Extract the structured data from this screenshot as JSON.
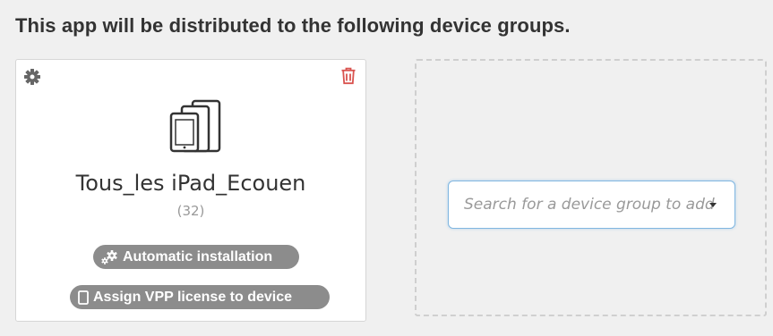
{
  "heading": "This app will be distributed to the following device groups.",
  "group_card": {
    "name": "Tous_les iPad_Ecouen",
    "count": "(32)",
    "icons": {
      "settings": "gear-icon",
      "delete": "trash-icon",
      "device": "ipad-stack-icon"
    },
    "badges": [
      {
        "label": "Automatic installation",
        "icon": "gears-icon"
      },
      {
        "label": "Assign VPP license to device",
        "icon": "tablet-icon"
      }
    ]
  },
  "add_group": {
    "search_placeholder": "Search for a device group to add"
  },
  "colors": {
    "background": "#f0f0f0",
    "card": "#ffffff",
    "badge": "#8c8c8c",
    "delete": "#d9534f",
    "focus_border": "#80b6e0"
  }
}
